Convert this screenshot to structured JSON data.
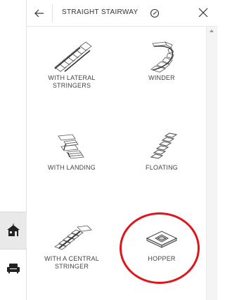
{
  "header": {
    "title": "STRAIGHT STAIRWAY",
    "back_icon": "arrow-left-icon",
    "clock_icon": "clock-icon",
    "close_icon": "close-icon"
  },
  "options": [
    {
      "label_lines": [
        "WITH LATERAL",
        "STRINGERS"
      ],
      "icon": "stair-lateral-stringers-icon"
    },
    {
      "label_lines": [
        "WINDER"
      ],
      "icon": "stair-winder-icon"
    },
    {
      "label_lines": [
        "WITH LANDING"
      ],
      "icon": "stair-landing-icon"
    },
    {
      "label_lines": [
        "FLOATING"
      ],
      "icon": "stair-floating-icon"
    },
    {
      "label_lines": [
        "WITH A CENTRAL",
        "STRINGER"
      ],
      "icon": "stair-central-stringer-icon"
    },
    {
      "label_lines": [
        "HOPPER"
      ],
      "icon": "stair-hopper-icon"
    }
  ],
  "sidebar": {
    "items": [
      {
        "icon": "house-icon",
        "active": true
      },
      {
        "icon": "sofa-icon",
        "active": false
      }
    ]
  },
  "highlight": {
    "target": "HOPPER",
    "color": "#e0141b"
  }
}
